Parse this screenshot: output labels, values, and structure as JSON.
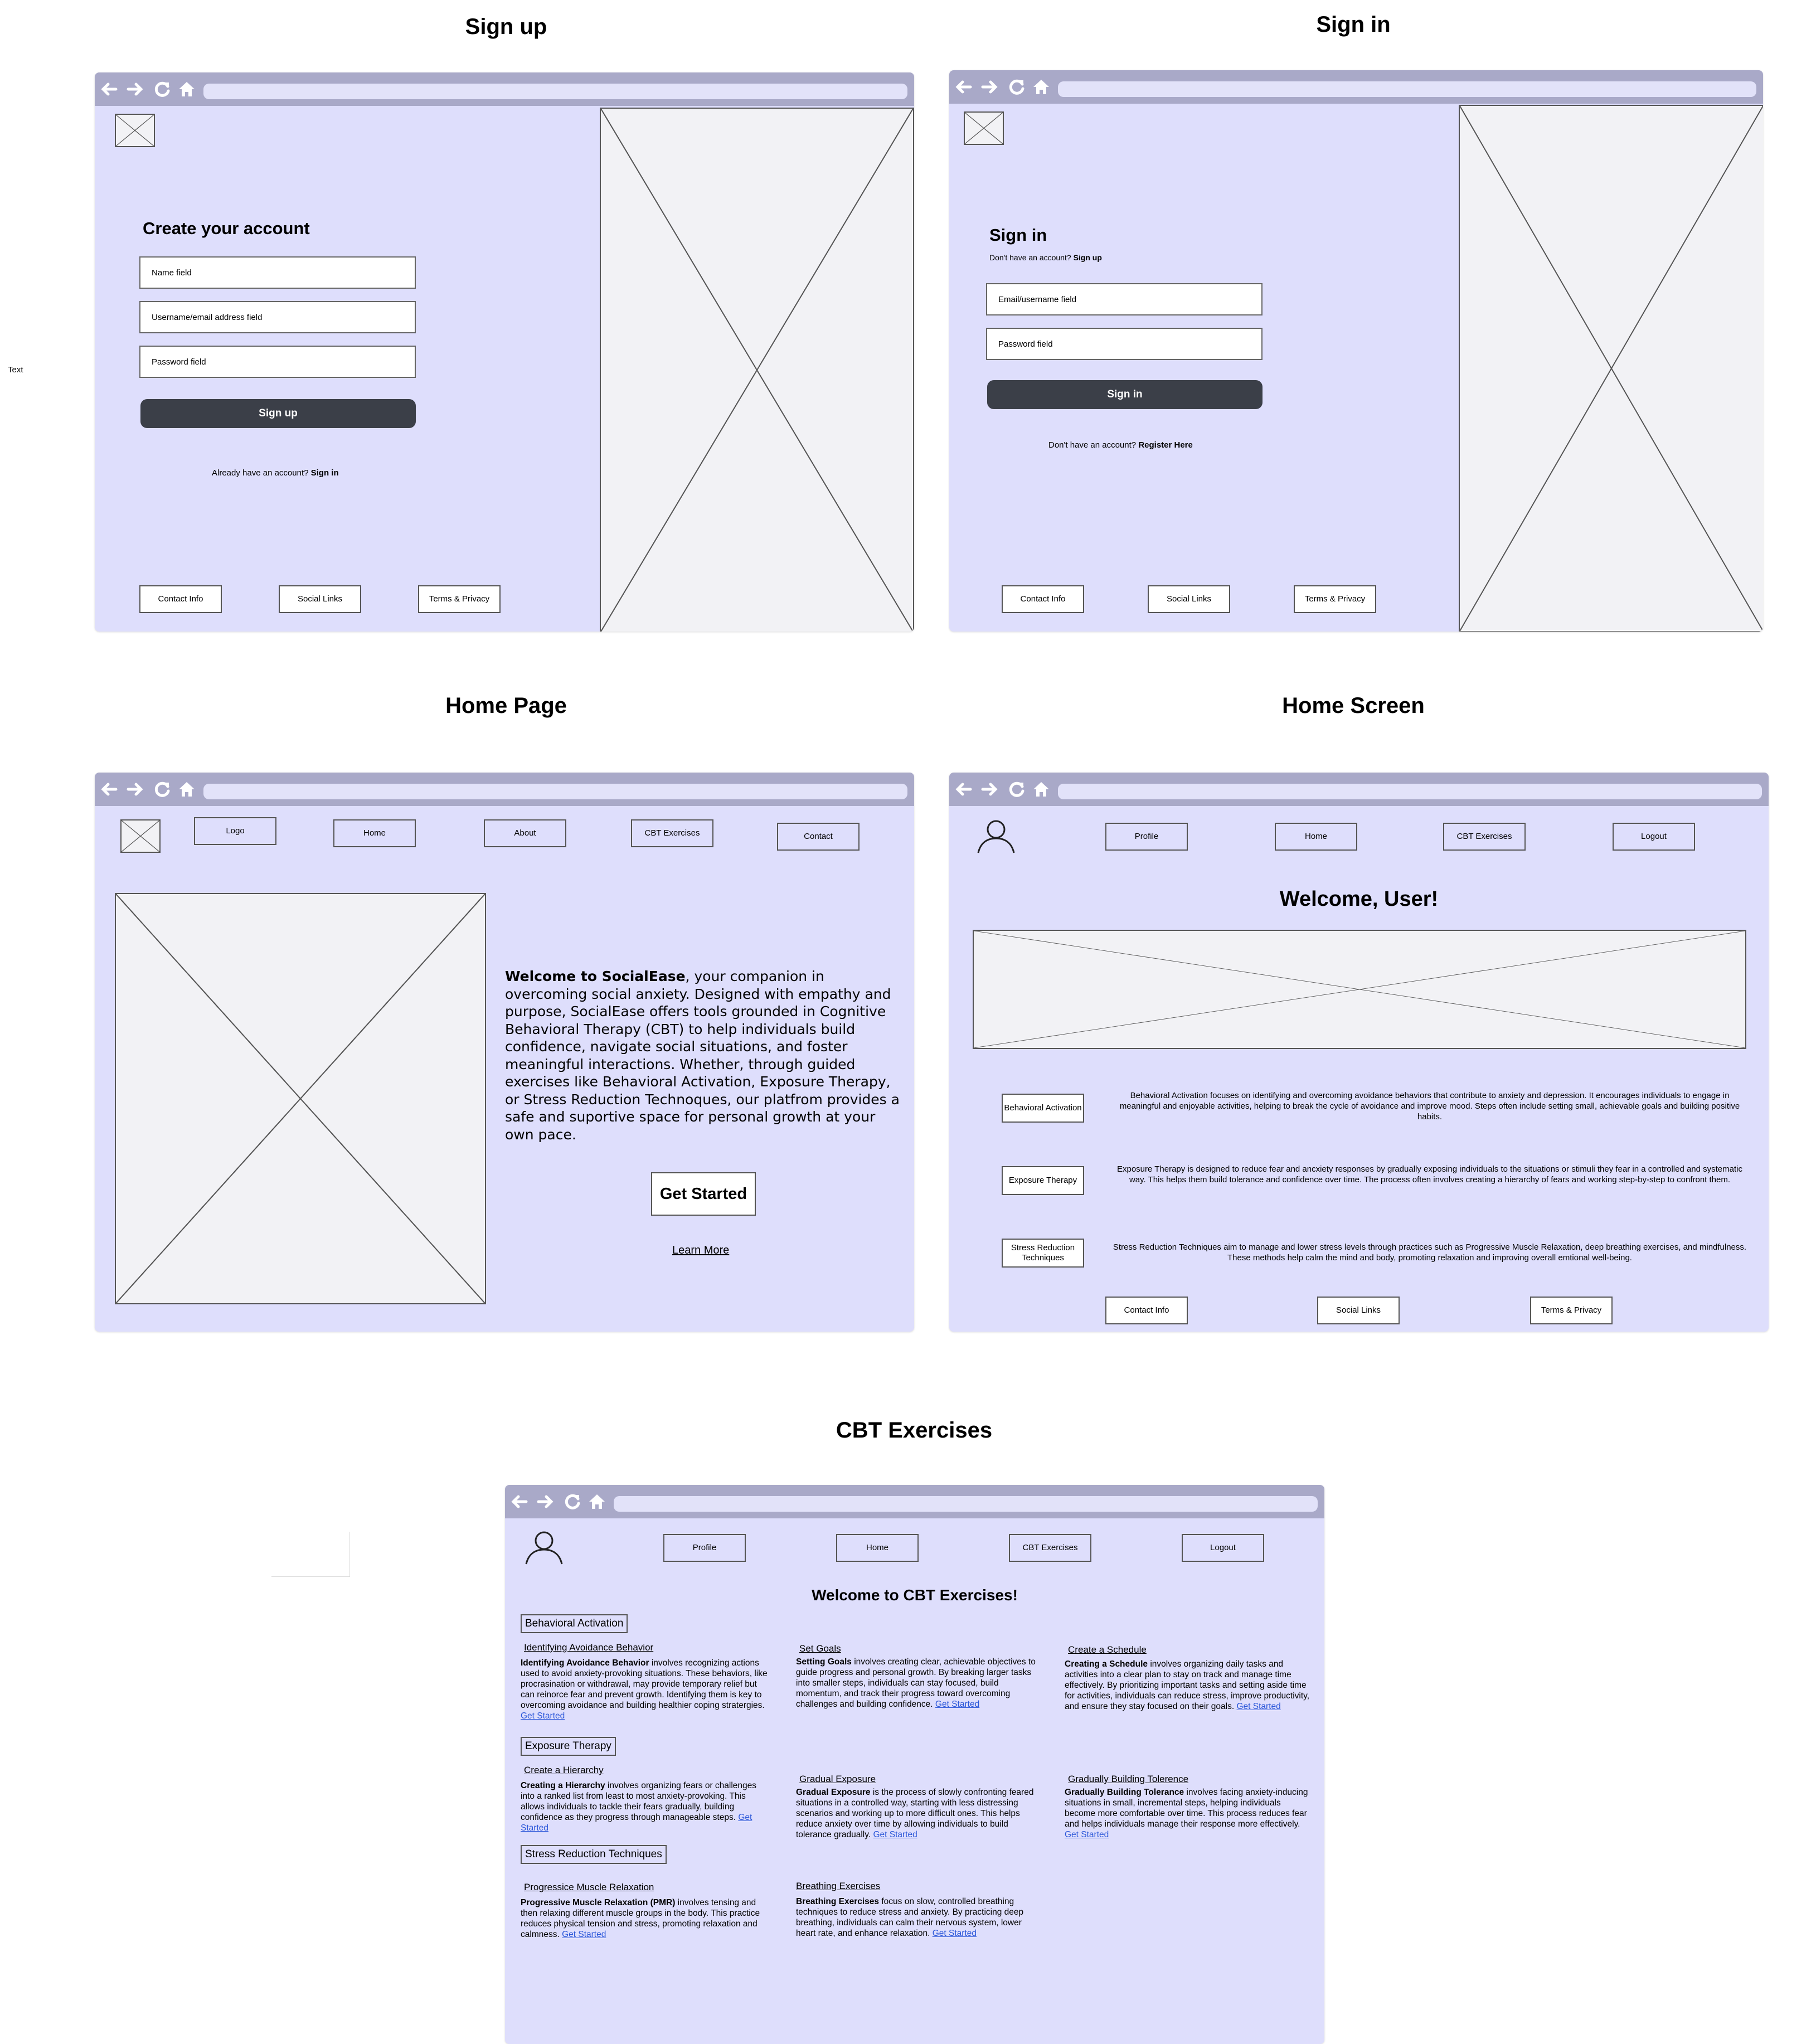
{
  "titles": {
    "signup": "Sign up",
    "signin": "Sign in",
    "homepage": "Home Page",
    "homescreen": "Home Screen",
    "cbt": "CBT Exercises"
  },
  "side_text": "Text",
  "signup": {
    "heading": "Create your account",
    "name_field": "Name field",
    "username_field": "Username/email address field",
    "password_field": "Password field",
    "button": "Sign up",
    "already_prefix": "Already have an account? ",
    "already_link": "Sign in",
    "footer": [
      "Contact Info",
      "Social Links",
      "Terms & Privacy"
    ]
  },
  "signin": {
    "heading": "Sign in",
    "no_account_prefix": "Don't have an account? ",
    "no_account_link": "Sign up",
    "email_field": "Email/username field",
    "password_field": "Password field",
    "button": "Sign in",
    "register_prefix": "Don't have an account? ",
    "register_link": "Register Here",
    "footer": [
      "Contact Info",
      "Social Links",
      "Terms & Privacy"
    ]
  },
  "homepage": {
    "nav": [
      "Logo",
      "Home",
      "About",
      "CBT Exercises",
      "Contact"
    ],
    "welcome_bold": "Welcome  to SocialEase",
    "welcome_rest": ", your companion in overcoming social anxiety. Designed with empathy and purpose, SocialEase offers tools grounded in Cognitive Behavioral Therapy (CBT) to help individuals build confidence, navigate social situations, and foster meaningful interactions. Whether, through guided exercises like Behavioral Activation, Exposure Therapy, or Stress Reduction Technoques, our platfrom provides a safe and suportive space for personal growth at your own pace.",
    "get_started": "Get Started",
    "learn_more": "Learn More"
  },
  "homescreen": {
    "nav": [
      "Profile",
      "Home",
      "CBT Exercises",
      "Logout"
    ],
    "welcome": "Welcome, User!",
    "items": [
      {
        "label": "Behavioral Activation",
        "text": "Behavioral Activation focuses on identifying and overcoming avoidance behaviors that contribute to anxiety and depression. It encourages individuals to engage in meaningful and enjoyable activities, helping to break the cycle of avoidance and improve mood. Steps often include setting small, achievable goals and building positive habits."
      },
      {
        "label": "Exposure Therapy",
        "text": "Exposure Therapy is designed to reduce fear and ancxiety responses by gradually exposing individuals to the situations or stimuli they fear in a controlled and systematic way. This helps them build tolerance and confidence over time. The process often involves creating a hierarchy of fears and working step-by-step to confront them."
      },
      {
        "label": "Stress Reduction Techniques",
        "text": "Stress Reduction Techniques aim to manage and lower stress levels through practices such as Progressive Muscle Relaxation, deep breathing exercises, and mindfulness. These methods help calm the mind and body, promoting relaxation and improving overall emtional well-being."
      }
    ],
    "footer": [
      "Contact Info",
      "Social Links",
      "Terms & Privacy"
    ]
  },
  "cbt": {
    "nav": [
      "Profile",
      "Home",
      "CBT Exercises",
      "Logout"
    ],
    "welcome": "Welcome to CBT Exercises!",
    "link_label": "Get Started",
    "categories": [
      "Behavioral Activation",
      "Exposure Therapy",
      "Stress Reduction Techniques"
    ],
    "exercises": [
      {
        "title": "Identifying Avoidance Behavior",
        "bold": "Identifying Avoidance Behavior",
        "text": " involves recognizing actions used to avoid anxiety-provoking situations. These behaviors, like procrasination or withdrawal, may provide temporary relief but can reinorce fear and prevent growth. Identifying them is key to overcoming avoidance and building healthier coping stratergies. "
      },
      {
        "title": "Set Goals",
        "bold": "Setting Goals",
        "text": " involves creating clear, achievable objectives to guide progress and personal growth. By breaking larger tasks into smaller steps, individuals can stay focused, build momentum, and track their progress toward overcoming challenges and building confidence. "
      },
      {
        "title": "Create a Schedule",
        "bold": "Creating a Schedule",
        "text": " involves organizing daily tasks and activities into a  clear plan to stay on track and manage time effectively. By prioritizing important tasks and setting aside time for activities, individuals can reduce stress, improve productivity, and ensure they stay focused on their goals. "
      },
      {
        "title": "Create a Hierarchy",
        "bold": "Creating a Hierarchy",
        "text": " involves organizing fears or challenges into a ranked list from least to most anxiety-provoking. This allows individuals to tackle their fears gradually, building confidence as they progress through manageable steps. "
      },
      {
        "title": "Gradual Exposure",
        "bold": "Gradual Exposure",
        "text": " is the process of slowly confronting feared situations in a controlled way, starting with less distressing scenarios and working up to more difficult ones. This helps reduce anxiety over time by allowing individuals to build tolerance gradually. "
      },
      {
        "title": "Gradually Building Tolerence",
        "bold": "Gradually Building Tolerance",
        "text": " involves facing anxiety-inducing situations in small, incremental steps, helping individuals become more comfortable over time. This process reduces fear and helps individuals manage their response more effectively. "
      },
      {
        "title": "Progressice Muscle Relaxation",
        "bold": "Progressive Muscle Relaxation (PMR)",
        "text": " involves tensing and then relaxing different muscle groups in the body. This practice reduces physical tension and stress, promoting relaxation and calmness. "
      },
      {
        "title": "Breathing Exercises",
        "bold": "Breathing Exercises",
        "text": " focus on slow, controlled breathing techniques to reduce stress and anxiety. By practicing deep breathing, individuals can calm their nervous system, lower heart rate, and enhance relaxation. "
      }
    ]
  },
  "colors": {
    "panel": "#dedefc",
    "chrome": "#a9a9c8",
    "button_dark": "#3b3f48",
    "link": "#2b57d9"
  }
}
